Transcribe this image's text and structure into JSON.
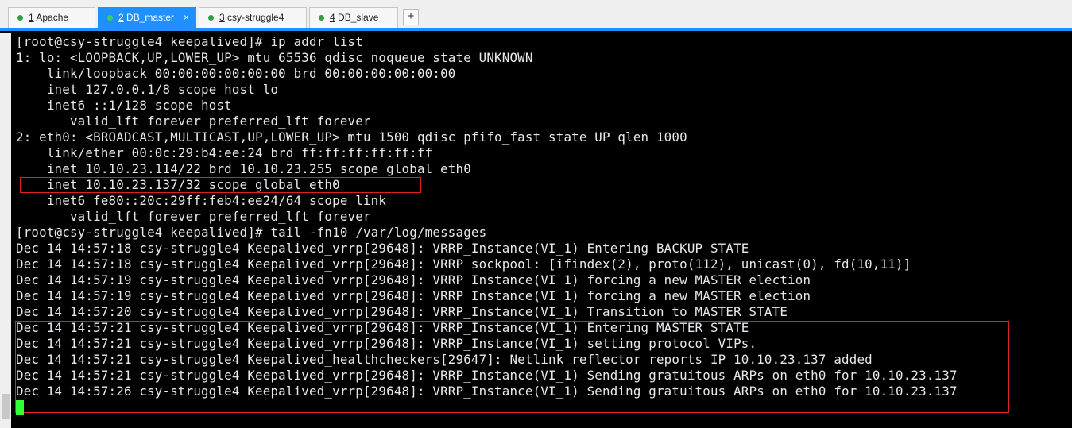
{
  "tabs": [
    {
      "num": "1",
      "title": " Apache",
      "active": false
    },
    {
      "num": "2",
      "title": " DB_master",
      "active": true
    },
    {
      "num": "3",
      "title": " csy-struggle4",
      "active": false
    },
    {
      "num": "4",
      "title": " DB_slave",
      "active": false
    }
  ],
  "tab_close_glyph": "×",
  "add_tab_label": "+",
  "terminal": {
    "lines": [
      "[root@csy-struggle4 keepalived]# ip addr list",
      "1: lo: <LOOPBACK,UP,LOWER_UP> mtu 65536 qdisc noqueue state UNKNOWN",
      "    link/loopback 00:00:00:00:00:00 brd 00:00:00:00:00:00",
      "    inet 127.0.0.1/8 scope host lo",
      "    inet6 ::1/128 scope host",
      "       valid_lft forever preferred_lft forever",
      "2: eth0: <BROADCAST,MULTICAST,UP,LOWER_UP> mtu 1500 qdisc pfifo_fast state UP qlen 1000",
      "    link/ether 00:0c:29:b4:ee:24 brd ff:ff:ff:ff:ff:ff",
      "    inet 10.10.23.114/22 brd 10.10.23.255 scope global eth0",
      "    inet 10.10.23.137/32 scope global eth0",
      "    inet6 fe80::20c:29ff:feb4:ee24/64 scope link",
      "       valid_lft forever preferred_lft forever",
      "[root@csy-struggle4 keepalived]# tail -fn10 /var/log/messages",
      "Dec 14 14:57:18 csy-struggle4 Keepalived_vrrp[29648]: VRRP_Instance(VI_1) Entering BACKUP STATE",
      "Dec 14 14:57:18 csy-struggle4 Keepalived_vrrp[29648]: VRRP sockpool: [ifindex(2), proto(112), unicast(0), fd(10,11)]",
      "Dec 14 14:57:19 csy-struggle4 Keepalived_vrrp[29648]: VRRP_Instance(VI_1) forcing a new MASTER election",
      "Dec 14 14:57:19 csy-struggle4 Keepalived_vrrp[29648]: VRRP_Instance(VI_1) forcing a new MASTER election",
      "Dec 14 14:57:20 csy-struggle4 Keepalived_vrrp[29648]: VRRP_Instance(VI_1) Transition to MASTER STATE",
      "Dec 14 14:57:21 csy-struggle4 Keepalived_vrrp[29648]: VRRP_Instance(VI_1) Entering MASTER STATE",
      "Dec 14 14:57:21 csy-struggle4 Keepalived_vrrp[29648]: VRRP_Instance(VI_1) setting protocol VIPs.",
      "Dec 14 14:57:21 csy-struggle4 Keepalived_healthcheckers[29647]: Netlink reflector reports IP 10.10.23.137 added",
      "Dec 14 14:57:21 csy-struggle4 Keepalived_vrrp[29648]: VRRP_Instance(VI_1) Sending gratuitous ARPs on eth0 for 10.10.23.137",
      "Dec 14 14:57:26 csy-struggle4 Keepalived_vrrp[29648]: VRRP_Instance(VI_1) Sending gratuitous ARPs on eth0 for 10.10.23.137"
    ]
  },
  "colors": {
    "accent": "#1e90ff",
    "terminal_bg": "#000000",
    "terminal_fg": "#e8e8e8",
    "highlight_box": "#e02020",
    "cursor": "#33ff33"
  }
}
